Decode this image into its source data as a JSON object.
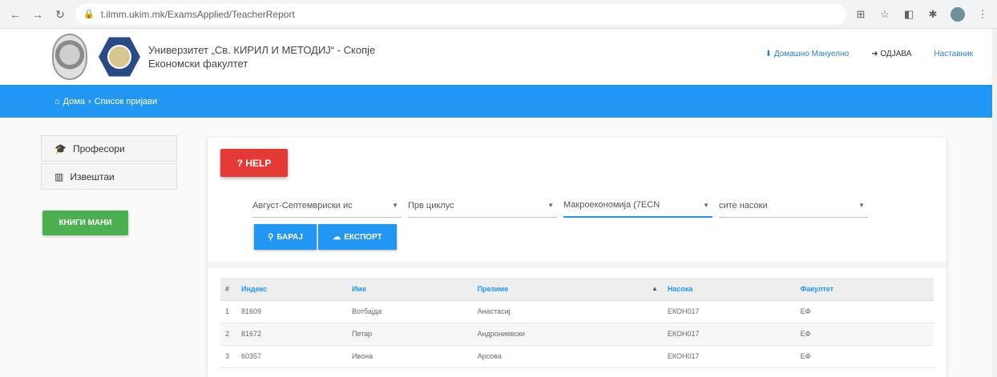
{
  "browser": {
    "url": "t.ilmm.ukim.mk/ExamsApplied/TeacherReport",
    "back_icon": "arrow-left-icon",
    "forward_icon": "arrow-right-icon",
    "reload_icon": "reload-icon"
  },
  "header": {
    "university_line1": "Универзитет „Св. КИРИЛ И МЕТОДИЈ“ - Скопје",
    "university_line2": "Економски факултет",
    "link_download": "Домашно Мануелно",
    "link_logout": "ОДЈАВА",
    "link_user": "Наставник"
  },
  "breadcrumb": {
    "home": "Дома",
    "current": "Список пријави"
  },
  "sidebar": {
    "items": [
      {
        "label": "Професори",
        "icon": "graduation-cap-icon"
      },
      {
        "label": "Извештаи",
        "icon": "bar-chart-icon"
      }
    ],
    "green_button": "КНИГИ МАНИ"
  },
  "panel": {
    "help_label": "HELP",
    "filters": {
      "session": "Август-Септемвриски ис",
      "cycle": "Прв циклус",
      "subject": "Макроекономија (7ЕСN",
      "hours": "сите насоки"
    },
    "search_label": "БАРАЈ",
    "export_label": "ЕКСПОРТ"
  },
  "table": {
    "headers": [
      "#",
      "Индекс",
      "Име",
      "Презиме",
      "Насока",
      "Факултет"
    ],
    "rows": [
      [
        "1",
        "81609",
        "Вотбајда",
        "Анастасиј",
        "ЕКОН017",
        "ЕФ"
      ],
      [
        "2",
        "81672",
        "Петар",
        "Андрониевски",
        "ЕКОН017",
        "ЕФ"
      ],
      [
        "3",
        "60357",
        "Ивона",
        "Арсова",
        "ЕКОН017",
        "ЕФ"
      ]
    ]
  },
  "colors": {
    "primary_blue": "#2196f3",
    "help_red": "#e53935",
    "green": "#4caf50"
  }
}
